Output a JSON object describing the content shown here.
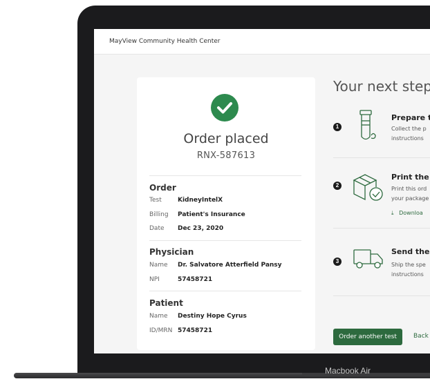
{
  "app": {
    "title": "MayView Community Health Center"
  },
  "summary": {
    "title": "Order placed",
    "order_id": "RNX-587613",
    "order": {
      "heading": "Order",
      "test_label": "Test",
      "test_value": "KidneyIntelX",
      "billing_label": "Billing",
      "billing_value": "Patient's Insurance",
      "date_label": "Date",
      "date_value": "Dec 23, 2020"
    },
    "physician": {
      "heading": "Physician",
      "name_label": "Name",
      "name_value": "Dr. Salvatore Atterfield Pansy",
      "npi_label": "NPI",
      "npi_value": "57458721"
    },
    "patient": {
      "heading": "Patient",
      "name_label": "Name",
      "name_value": "Destiny Hope Cyrus",
      "id_label": "ID/MRN",
      "id_value": "57458721"
    }
  },
  "steps": {
    "title": "Your next step",
    "items": [
      {
        "number": "1",
        "heading": "Prepare th",
        "desc_line1": "Collect the p",
        "desc_line2": "instructions",
        "icon": "test-tube-icon"
      },
      {
        "number": "2",
        "heading": "Print the",
        "desc_line1": "Print this ord",
        "desc_line2": "your package",
        "link": "Downloa",
        "icon": "package-check-icon"
      },
      {
        "number": "3",
        "heading": "Send the",
        "desc_line1": "Ship the spe",
        "desc_line2": "instructions",
        "icon": "truck-icon"
      }
    ]
  },
  "actions": {
    "order_another": "Order another test",
    "back": "Back"
  },
  "device": {
    "brand": "Macbook Air"
  },
  "colors": {
    "accent": "#2d6a3e",
    "check": "#2d8a4e"
  }
}
